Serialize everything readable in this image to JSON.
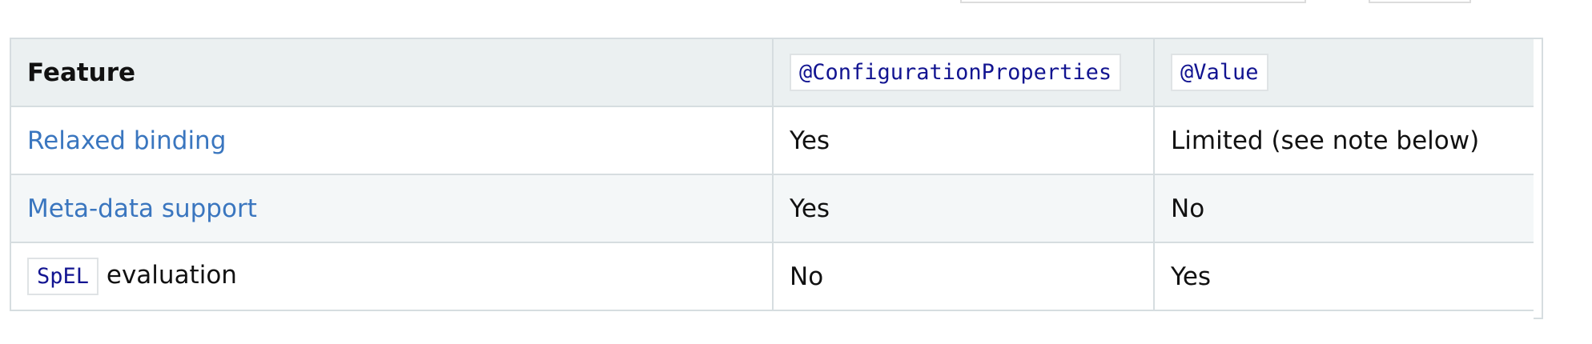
{
  "table": {
    "headers": {
      "feature": "Feature",
      "configuration_properties": "@ConfigurationProperties",
      "value": "@Value"
    },
    "rows": [
      {
        "feature_link": "Relaxed binding",
        "configuration_properties": "Yes",
        "value": "Limited (see note below)"
      },
      {
        "feature_link": "Meta-data support",
        "configuration_properties": "Yes",
        "value": "No"
      },
      {
        "feature_code": "SpEL",
        "feature_text": "evaluation",
        "configuration_properties": "No",
        "value": "Yes"
      }
    ]
  },
  "colors": {
    "link": "#3a76bf",
    "code": "#121491",
    "header_bg": "#ebf0f1",
    "stripe_bg": "#f4f7f8",
    "border": "#d6dde0"
  }
}
